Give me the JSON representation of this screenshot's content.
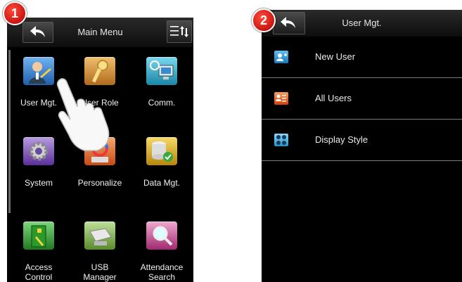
{
  "step_badges": [
    "1",
    "2"
  ],
  "main_menu": {
    "title": "Main Menu",
    "items": [
      {
        "label": "User Mgt.",
        "icon": "user-mgt-icon",
        "color": "#2f7fd6"
      },
      {
        "label": "User Role",
        "icon": "key-icon",
        "color": "#d89a3a"
      },
      {
        "label": "Comm.",
        "icon": "network-icon",
        "color": "#29a9c9"
      },
      {
        "label": "System",
        "icon": "gear-icon",
        "color": "#7a4fb5"
      },
      {
        "label": "Personalize",
        "icon": "palette-icon",
        "color": "#e26a2a"
      },
      {
        "label": "Data Mgt.",
        "icon": "database-icon",
        "color": "#e0b020"
      },
      {
        "label": "Access\nControl",
        "icon": "door-icon",
        "color": "#3aa83a"
      },
      {
        "label": "USB\nManager",
        "icon": "usb-drive-icon",
        "color": "#7ab04a"
      },
      {
        "label": "Attendance\nSearch",
        "icon": "magnifier-icon",
        "color": "#c04a90"
      }
    ]
  },
  "user_mgt": {
    "title": "User Mgt.",
    "items": [
      {
        "label": "New User",
        "icon": "add-user-icon",
        "color": "#2a8fd0"
      },
      {
        "label": "All Users",
        "icon": "user-list-icon",
        "color": "#e05a20"
      },
      {
        "label": "Display Style",
        "icon": "display-style-icon",
        "color": "#2a8fd0"
      }
    ]
  }
}
